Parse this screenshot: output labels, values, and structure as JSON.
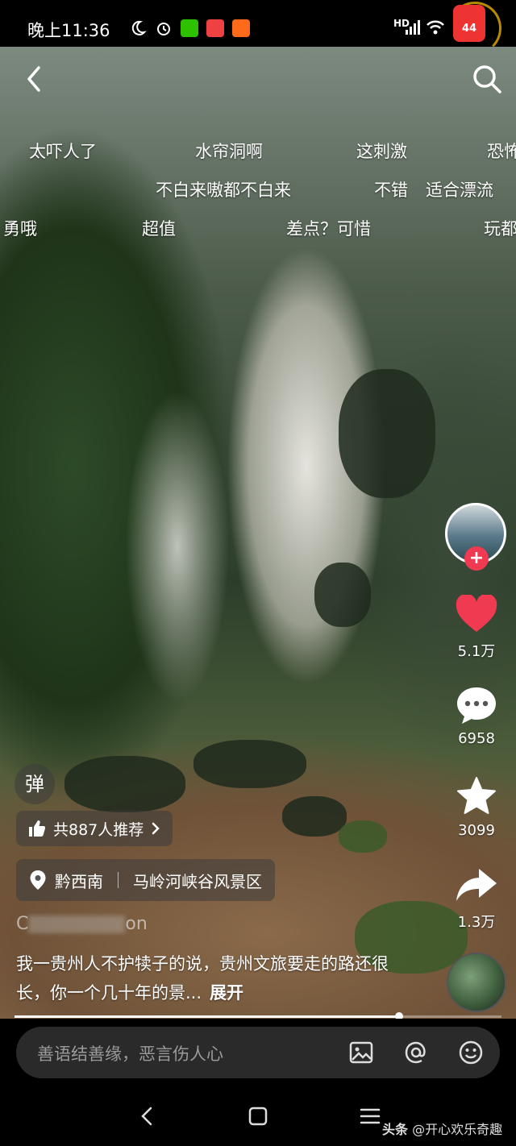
{
  "status_bar": {
    "time": "晚上11:36",
    "network": "HD",
    "battery_badge": "44"
  },
  "danmaku": [
    "太吓人了",
    "水帘洞啊",
    "这刺激",
    "恐怖",
    "不白来嗷都不白来",
    "不错",
    "适合漂流",
    "勇哦",
    "超值",
    "差点？可惜",
    "玩都"
  ],
  "actions": {
    "likes": "5.1万",
    "comments": "6958",
    "favorites": "3099",
    "shares": "1.3万"
  },
  "overlay": {
    "danmaku_button": "弹",
    "recommend": "共887人推荐",
    "location_region": "黔西南",
    "location_place": "马岭河峡谷风景区",
    "author_visible": "C",
    "author_tail": "on",
    "description": "我一贵州人不护犊子的说，贵州文旅要走的路还很长，你一个几十年的景...",
    "expand": "展开"
  },
  "progress": {
    "percent": 79
  },
  "comment_bar": {
    "placeholder": "善语结善缘，恶言伤人心"
  },
  "watermark": {
    "brand": "头条",
    "handle": "@开心欢乐奇趣"
  },
  "colors": {
    "like": "#f03a52",
    "accent_plus": "#f03a52"
  }
}
